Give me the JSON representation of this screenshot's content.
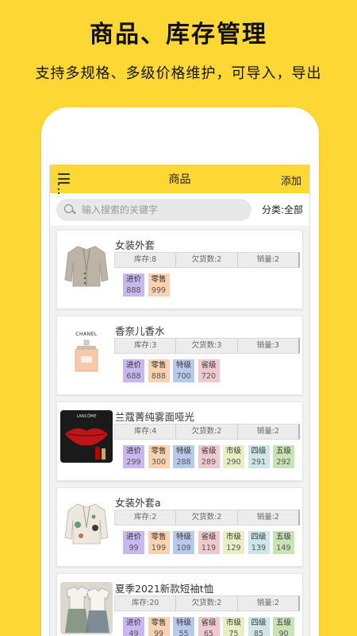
{
  "promo": {
    "headline": "商品、库存管理",
    "subline": "支持多规格、多级价格维护，可导入，导出"
  },
  "appbar": {
    "title": "商品",
    "add_label": "添加",
    "menu_icon": "menu-icon"
  },
  "search": {
    "placeholder": "输入搜索的关键字",
    "category_label": "分类:全部"
  },
  "colors": {
    "accent": "#FDD835",
    "price_tags": {
      "进价": "#c9b8f0",
      "零售": "#fbd2b0",
      "特级": "#b9c9ec",
      "省级": "#efc9cf",
      "市级": "#e9efc2",
      "四级": "#cde6ea",
      "五级": "#c8e3b6"
    }
  },
  "products": [
    {
      "name": "女装外套",
      "stock": "库存:8",
      "owed": "欠货数:2",
      "sales": "销量:2",
      "prices": [
        {
          "label": "进价",
          "value": "888"
        },
        {
          "label": "零售",
          "value": "999"
        }
      ]
    },
    {
      "name": "香奈儿香水",
      "brand_text": "CHANEL",
      "stock": "库存:3",
      "owed": "欠货数:3",
      "sales": "销量:3",
      "prices": [
        {
          "label": "进价",
          "value": "688"
        },
        {
          "label": "零售",
          "value": "888"
        },
        {
          "label": "特级",
          "value": "700"
        },
        {
          "label": "省级",
          "value": "720"
        }
      ]
    },
    {
      "name": "兰蔻菁纯雾面哑光",
      "brand_text": "LANCÔME",
      "stock": "库存:4",
      "owed": "欠货数:2",
      "sales": "销量:2",
      "prices": [
        {
          "label": "进价",
          "value": "299"
        },
        {
          "label": "零售",
          "value": "300"
        },
        {
          "label": "特级",
          "value": "288"
        },
        {
          "label": "省级",
          "value": "289"
        },
        {
          "label": "市级",
          "value": "290"
        },
        {
          "label": "四级",
          "value": "291"
        },
        {
          "label": "五级",
          "value": "292"
        }
      ]
    },
    {
      "name": "女装外套a",
      "stock": "库存:2",
      "owed": "欠货数:2",
      "sales": "销量:2",
      "prices": [
        {
          "label": "进价",
          "value": "99"
        },
        {
          "label": "零售",
          "value": "199"
        },
        {
          "label": "特级",
          "value": "109"
        },
        {
          "label": "省级",
          "value": "119"
        },
        {
          "label": "市级",
          "value": "129"
        },
        {
          "label": "四级",
          "value": "139"
        },
        {
          "label": "五级",
          "value": "149"
        }
      ]
    },
    {
      "name": "夏季2021新款短袖t恤",
      "stock": "库存:20",
      "owed": "欠货数:2",
      "sales": "销量:2",
      "prices": [
        {
          "label": "进价",
          "value": "49"
        },
        {
          "label": "零售",
          "value": "99"
        },
        {
          "label": "特级",
          "value": "55"
        },
        {
          "label": "省级",
          "value": "65"
        },
        {
          "label": "市级",
          "value": "75"
        },
        {
          "label": "四级",
          "value": "85"
        },
        {
          "label": "五级",
          "value": "90"
        }
      ]
    }
  ]
}
